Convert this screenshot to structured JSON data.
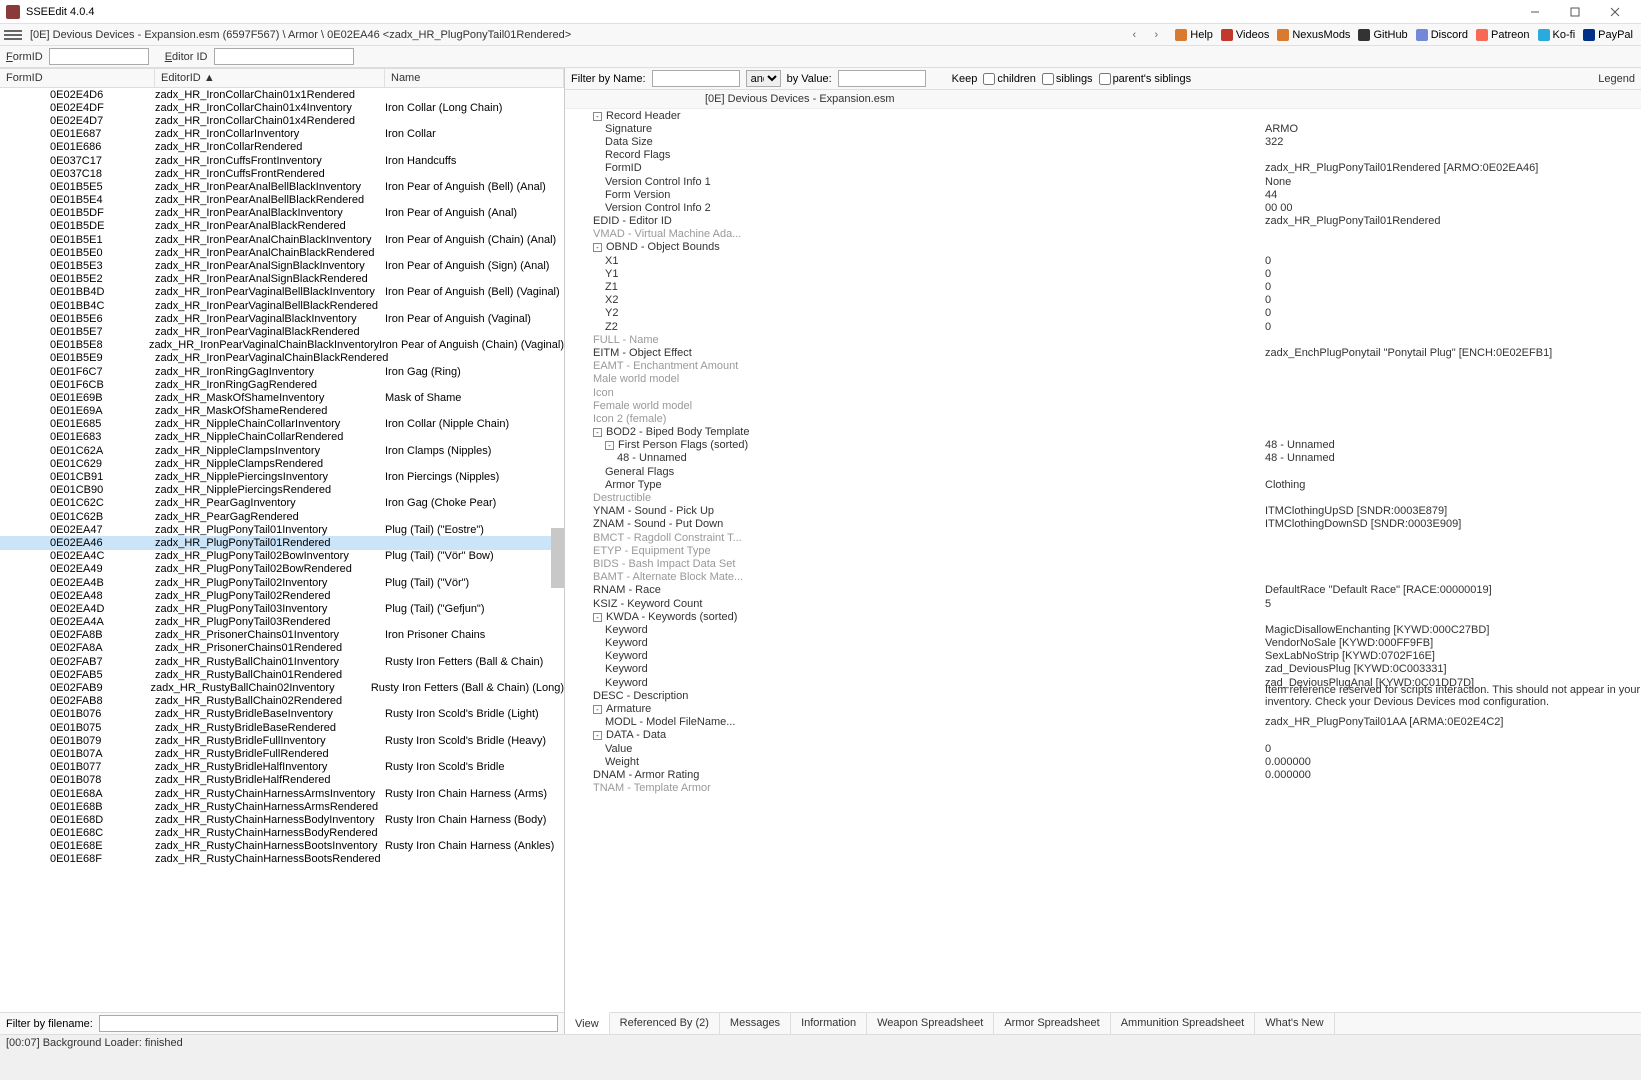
{
  "title": "SSEEdit 4.0.4",
  "crumb": "[0E] Devious Devices - Expansion.esm (6597F567) \\ Armor \\ 0E02EA46 <zadx_HR_PlugPonyTail01Rendered>",
  "ext_links": [
    "Help",
    "Videos",
    "NexusMods",
    "GitHub",
    "Discord",
    "Patreon",
    "Ko-fi",
    "PayPal"
  ],
  "formid_label": "FormID",
  "editorid_label": "Editor ID",
  "left_cols": {
    "formid": "FormID",
    "editorid": "EditorID",
    "name": "Name",
    "sort": "▲"
  },
  "rows": [
    {
      "f": "0E02E4D6",
      "e": "zadx_HR_IronCollarChain01x1Rendered",
      "n": ""
    },
    {
      "f": "0E02E4DF",
      "e": "zadx_HR_IronCollarChain01x4Inventory",
      "n": "Iron Collar (Long Chain)"
    },
    {
      "f": "0E02E4D7",
      "e": "zadx_HR_IronCollarChain01x4Rendered",
      "n": ""
    },
    {
      "f": "0E01E687",
      "e": "zadx_HR_IronCollarInventory",
      "n": "Iron Collar"
    },
    {
      "f": "0E01E686",
      "e": "zadx_HR_IronCollarRendered",
      "n": ""
    },
    {
      "f": "0E037C17",
      "e": "zadx_HR_IronCuffsFrontInventory",
      "n": "Iron Handcuffs"
    },
    {
      "f": "0E037C18",
      "e": "zadx_HR_IronCuffsFrontRendered",
      "n": ""
    },
    {
      "f": "0E01B5E5",
      "e": "zadx_HR_IronPearAnalBellBlackInventory",
      "n": "Iron Pear of Anguish (Bell) (Anal)"
    },
    {
      "f": "0E01B5E4",
      "e": "zadx_HR_IronPearAnalBellBlackRendered",
      "n": ""
    },
    {
      "f": "0E01B5DF",
      "e": "zadx_HR_IronPearAnalBlackInventory",
      "n": "Iron Pear of Anguish (Anal)"
    },
    {
      "f": "0E01B5DE",
      "e": "zadx_HR_IronPearAnalBlackRendered",
      "n": ""
    },
    {
      "f": "0E01B5E1",
      "e": "zadx_HR_IronPearAnalChainBlackInventory",
      "n": "Iron Pear of Anguish (Chain) (Anal)"
    },
    {
      "f": "0E01B5E0",
      "e": "zadx_HR_IronPearAnalChainBlackRendered",
      "n": ""
    },
    {
      "f": "0E01B5E3",
      "e": "zadx_HR_IronPearAnalSignBlackInventory",
      "n": "Iron Pear of Anguish (Sign) (Anal)"
    },
    {
      "f": "0E01B5E2",
      "e": "zadx_HR_IronPearAnalSignBlackRendered",
      "n": ""
    },
    {
      "f": "0E01BB4D",
      "e": "zadx_HR_IronPearVaginalBellBlackInventory",
      "n": "Iron Pear of Anguish (Bell) (Vaginal)"
    },
    {
      "f": "0E01BB4C",
      "e": "zadx_HR_IronPearVaginalBellBlackRendered",
      "n": ""
    },
    {
      "f": "0E01B5E6",
      "e": "zadx_HR_IronPearVaginalBlackInventory",
      "n": "Iron Pear of Anguish (Vaginal)"
    },
    {
      "f": "0E01B5E7",
      "e": "zadx_HR_IronPearVaginalBlackRendered",
      "n": ""
    },
    {
      "f": "0E01B5E8",
      "e": "zadx_HR_IronPearVaginalChainBlackInventory",
      "n": "Iron Pear of Anguish (Chain) (Vaginal)"
    },
    {
      "f": "0E01B5E9",
      "e": "zadx_HR_IronPearVaginalChainBlackRendered",
      "n": ""
    },
    {
      "f": "0E01F6C7",
      "e": "zadx_HR_IronRingGagInventory",
      "n": "Iron Gag (Ring)"
    },
    {
      "f": "0E01F6CB",
      "e": "zadx_HR_IronRingGagRendered",
      "n": ""
    },
    {
      "f": "0E01E69B",
      "e": "zadx_HR_MaskOfShameInventory",
      "n": "Mask of Shame"
    },
    {
      "f": "0E01E69A",
      "e": "zadx_HR_MaskOfShameRendered",
      "n": ""
    },
    {
      "f": "0E01E685",
      "e": "zadx_HR_NippleChainCollarInventory",
      "n": "Iron Collar (Nipple Chain)"
    },
    {
      "f": "0E01E683",
      "e": "zadx_HR_NippleChainCollarRendered",
      "n": ""
    },
    {
      "f": "0E01C62A",
      "e": "zadx_HR_NippleClampsInventory",
      "n": "Iron Clamps (Nipples)"
    },
    {
      "f": "0E01C629",
      "e": "zadx_HR_NippleClampsRendered",
      "n": ""
    },
    {
      "f": "0E01CB91",
      "e": "zadx_HR_NipplePiercingsInventory",
      "n": "Iron Piercings (Nipples)"
    },
    {
      "f": "0E01CB90",
      "e": "zadx_HR_NipplePiercingsRendered",
      "n": ""
    },
    {
      "f": "0E01C62C",
      "e": "zadx_HR_PearGagInventory",
      "n": "Iron Gag (Choke Pear)"
    },
    {
      "f": "0E01C62B",
      "e": "zadx_HR_PearGagRendered",
      "n": ""
    },
    {
      "f": "0E02EA47",
      "e": "zadx_HR_PlugPonyTail01Inventory",
      "n": "Plug (Tail) (\"Eostre\")"
    },
    {
      "f": "0E02EA46",
      "e": "zadx_HR_PlugPonyTail01Rendered",
      "n": "",
      "sel": true
    },
    {
      "f": "0E02EA4C",
      "e": "zadx_HR_PlugPonyTail02BowInventory",
      "n": "Plug (Tail) (\"Vör\" Bow)"
    },
    {
      "f": "0E02EA49",
      "e": "zadx_HR_PlugPonyTail02BowRendered",
      "n": ""
    },
    {
      "f": "0E02EA4B",
      "e": "zadx_HR_PlugPonyTail02Inventory",
      "n": "Plug (Tail) (\"Vör\")"
    },
    {
      "f": "0E02EA48",
      "e": "zadx_HR_PlugPonyTail02Rendered",
      "n": ""
    },
    {
      "f": "0E02EA4D",
      "e": "zadx_HR_PlugPonyTail03Inventory",
      "n": "Plug (Tail) (\"Gefjun\")"
    },
    {
      "f": "0E02EA4A",
      "e": "zadx_HR_PlugPonyTail03Rendered",
      "n": ""
    },
    {
      "f": "0E02FA8B",
      "e": "zadx_HR_PrisonerChains01Inventory",
      "n": "Iron Prisoner Chains"
    },
    {
      "f": "0E02FA8A",
      "e": "zadx_HR_PrisonerChains01Rendered",
      "n": ""
    },
    {
      "f": "0E02FAB7",
      "e": "zadx_HR_RustyBallChain01Inventory",
      "n": "Rusty Iron Fetters (Ball & Chain)"
    },
    {
      "f": "0E02FAB5",
      "e": "zadx_HR_RustyBallChain01Rendered",
      "n": ""
    },
    {
      "f": "0E02FAB9",
      "e": "zadx_HR_RustyBallChain02Inventory",
      "n": "Rusty Iron Fetters (Ball & Chain) (Long)"
    },
    {
      "f": "0E02FAB8",
      "e": "zadx_HR_RustyBallChain02Rendered",
      "n": ""
    },
    {
      "f": "0E01B076",
      "e": "zadx_HR_RustyBridleBaseInventory",
      "n": "Rusty Iron Scold's Bridle (Light)"
    },
    {
      "f": "0E01B075",
      "e": "zadx_HR_RustyBridleBaseRendered",
      "n": ""
    },
    {
      "f": "0E01B079",
      "e": "zadx_HR_RustyBridleFullInventory",
      "n": "Rusty Iron Scold's Bridle (Heavy)"
    },
    {
      "f": "0E01B07A",
      "e": "zadx_HR_RustyBridleFullRendered",
      "n": ""
    },
    {
      "f": "0E01B077",
      "e": "zadx_HR_RustyBridleHalfInventory",
      "n": "Rusty Iron Scold's Bridle"
    },
    {
      "f": "0E01B078",
      "e": "zadx_HR_RustyBridleHalfRendered",
      "n": ""
    },
    {
      "f": "0E01E68A",
      "e": "zadx_HR_RustyChainHarnessArmsInventory",
      "n": "Rusty Iron Chain Harness (Arms)"
    },
    {
      "f": "0E01E68B",
      "e": "zadx_HR_RustyChainHarnessArmsRendered",
      "n": ""
    },
    {
      "f": "0E01E68D",
      "e": "zadx_HR_RustyChainHarnessBodyInventory",
      "n": "Rusty Iron Chain Harness (Body)"
    },
    {
      "f": "0E01E68C",
      "e": "zadx_HR_RustyChainHarnessBodyRendered",
      "n": ""
    },
    {
      "f": "0E01E68E",
      "e": "zadx_HR_RustyChainHarnessBootsInventory",
      "n": "Rusty Iron Chain Harness (Ankles)"
    },
    {
      "f": "0E01E68F",
      "e": "zadx_HR_RustyChainHarnessBootsRendered",
      "n": ""
    }
  ],
  "filter_label": "Filter by filename:",
  "right": {
    "filter_by_name": "Filter by Name:",
    "and": "and",
    "by_value": "by Value:",
    "keep": "Keep",
    "children": "children",
    "siblings": "siblings",
    "parents": "parent's siblings",
    "legend": "Legend",
    "plugin_header": "[0E] Devious Devices - Expansion.esm",
    "fields": [
      {
        "l": "Record Header",
        "i": 1,
        "exp": "-"
      },
      {
        "l": "Signature",
        "v": "ARMO",
        "i": 2
      },
      {
        "l": "Data Size",
        "v": "322",
        "i": 2
      },
      {
        "l": "Record Flags",
        "i": 2
      },
      {
        "l": "FormID",
        "v": "zadx_HR_PlugPonyTail01Rendered [ARMO:0E02EA46]",
        "i": 2
      },
      {
        "l": "Version Control Info 1",
        "v": "None",
        "i": 2
      },
      {
        "l": "Form Version",
        "v": "44",
        "i": 2
      },
      {
        "l": "Version Control Info 2",
        "v": "00 00",
        "i": 2
      },
      {
        "l": "EDID - Editor ID",
        "v": "zadx_HR_PlugPonyTail01Rendered",
        "i": 1
      },
      {
        "l": "VMAD - Virtual Machine Ada...",
        "i": 1,
        "muted": true
      },
      {
        "l": "OBND - Object Bounds",
        "i": 1,
        "exp": "-"
      },
      {
        "l": "X1",
        "v": "0",
        "i": 2
      },
      {
        "l": "Y1",
        "v": "0",
        "i": 2
      },
      {
        "l": "Z1",
        "v": "0",
        "i": 2
      },
      {
        "l": "X2",
        "v": "0",
        "i": 2
      },
      {
        "l": "Y2",
        "v": "0",
        "i": 2
      },
      {
        "l": "Z2",
        "v": "0",
        "i": 2
      },
      {
        "l": "FULL - Name",
        "i": 1,
        "muted": true
      },
      {
        "l": "EITM - Object Effect",
        "v": "zadx_EnchPlugPonytail \"Ponytail Plug\" [ENCH:0E02EFB1]",
        "i": 1
      },
      {
        "l": "EAMT - Enchantment Amount",
        "i": 1,
        "muted": true
      },
      {
        "l": "Male world model",
        "i": 1,
        "muted": true
      },
      {
        "l": "Icon",
        "i": 1,
        "muted": true
      },
      {
        "l": "Female world model",
        "i": 1,
        "muted": true
      },
      {
        "l": "Icon 2 (female)",
        "i": 1,
        "muted": true
      },
      {
        "l": "BOD2 - Biped Body Template",
        "i": 1,
        "exp": "-"
      },
      {
        "l": "First Person Flags (sorted)",
        "v": "48 - Unnamed",
        "i": 2,
        "exp": "-"
      },
      {
        "l": "48 - Unnamed",
        "v": "48 - Unnamed",
        "i": 3
      },
      {
        "l": "General Flags",
        "i": 2
      },
      {
        "l": "Armor Type",
        "v": "Clothing",
        "i": 2
      },
      {
        "l": "Destructible",
        "i": 1,
        "muted": true
      },
      {
        "l": "YNAM - Sound - Pick Up",
        "v": "ITMClothingUpSD [SNDR:0003E879]",
        "i": 1
      },
      {
        "l": "ZNAM - Sound - Put Down",
        "v": "ITMClothingDownSD [SNDR:0003E909]",
        "i": 1
      },
      {
        "l": "BMCT - Ragdoll Constraint T...",
        "i": 1,
        "muted": true
      },
      {
        "l": "ETYP - Equipment Type",
        "i": 1,
        "muted": true
      },
      {
        "l": "BIDS - Bash Impact Data Set",
        "i": 1,
        "muted": true
      },
      {
        "l": "BAMT - Alternate Block Mate...",
        "i": 1,
        "muted": true
      },
      {
        "l": "RNAM - Race",
        "v": "DefaultRace \"Default Race\" [RACE:00000019]",
        "i": 1
      },
      {
        "l": "KSIZ - Keyword Count",
        "v": "5",
        "i": 1
      },
      {
        "l": "KWDA - Keywords (sorted)",
        "i": 1,
        "exp": "-"
      },
      {
        "l": "Keyword",
        "v": "MagicDisallowEnchanting [KYWD:000C27BD]",
        "i": 2
      },
      {
        "l": "Keyword",
        "v": "VendorNoSale [KYWD:000FF9FB]",
        "i": 2
      },
      {
        "l": "Keyword",
        "v": "SexLabNoStrip [KYWD:0702F16E]",
        "i": 2
      },
      {
        "l": "Keyword",
        "v": "zad_DeviousPlug [KYWD:0C003331]",
        "i": 2
      },
      {
        "l": "Keyword",
        "v": "zad_DeviousPlugAnal [KYWD:0C01DD7D]",
        "i": 2
      },
      {
        "l": "DESC - Description",
        "v": "Item reference reserved for scripts interaction. This should not appear in your inventory. Check your Devious Devices mod configuration.",
        "i": 1
      },
      {
        "l": "Armature",
        "i": 1,
        "exp": "-"
      },
      {
        "l": "MODL - Model FileName...",
        "v": "zadx_HR_PlugPonyTail01AA [ARMA:0E02E4C2]",
        "i": 2
      },
      {
        "l": "DATA - Data",
        "i": 1,
        "exp": "-"
      },
      {
        "l": "Value",
        "v": "0",
        "i": 2
      },
      {
        "l": "Weight",
        "v": "0.000000",
        "i": 2
      },
      {
        "l": "DNAM - Armor Rating",
        "v": "0.000000",
        "i": 1
      },
      {
        "l": "TNAM - Template Armor",
        "i": 1,
        "muted": true
      }
    ]
  },
  "tabs": [
    "View",
    "Referenced By (2)",
    "Messages",
    "Information",
    "Weapon Spreadsheet",
    "Armor Spreadsheet",
    "Ammunition Spreadsheet",
    "What's New"
  ],
  "status": "[00:07] Background Loader: finished"
}
